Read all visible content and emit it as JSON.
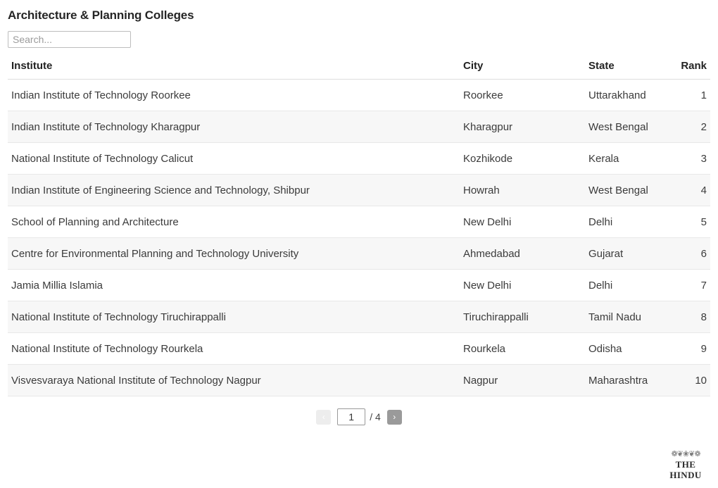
{
  "header": {
    "title": "Architecture & Planning Colleges"
  },
  "search": {
    "placeholder": "Search...",
    "value": ""
  },
  "table": {
    "columns": [
      {
        "key": "institute",
        "label": "Institute",
        "align": "left"
      },
      {
        "key": "city",
        "label": "City",
        "align": "left"
      },
      {
        "key": "state",
        "label": "State",
        "align": "left"
      },
      {
        "key": "rank",
        "label": "Rank",
        "align": "right"
      }
    ],
    "rows": [
      {
        "institute": "Indian Institute of Technology Roorkee",
        "city": "Roorkee",
        "state": "Uttarakhand",
        "rank": "1"
      },
      {
        "institute": "Indian Institute of Technology Kharagpur",
        "city": "Kharagpur",
        "state": "West Bengal",
        "rank": "2"
      },
      {
        "institute": "National Institute of Technology Calicut",
        "city": "Kozhikode",
        "state": "Kerala",
        "rank": "3"
      },
      {
        "institute": "Indian Institute of Engineering Science and Technology, Shibpur",
        "city": "Howrah",
        "state": "West Bengal",
        "rank": "4"
      },
      {
        "institute": "School of Planning and Architecture",
        "city": "New Delhi",
        "state": "Delhi",
        "rank": "5"
      },
      {
        "institute": "Centre for Environmental Planning and Technology University",
        "city": "Ahmedabad",
        "state": "Gujarat",
        "rank": "6"
      },
      {
        "institute": "Jamia Millia Islamia",
        "city": "New Delhi",
        "state": "Delhi",
        "rank": "7"
      },
      {
        "institute": "National Institute of Technology Tiruchirappalli",
        "city": "Tiruchirappalli",
        "state": "Tamil Nadu",
        "rank": "8"
      },
      {
        "institute": "National Institute of Technology Rourkela",
        "city": "Rourkela",
        "state": "Odisha",
        "rank": "9"
      },
      {
        "institute": "Visvesvaraya National Institute of Technology Nagpur",
        "city": "Nagpur",
        "state": "Maharashtra",
        "rank": "10"
      }
    ]
  },
  "pagination": {
    "prev_label": "‹",
    "next_label": "›",
    "current_page": "1",
    "total_label": "/ 4",
    "total_pages": "4",
    "prev_enabled": false,
    "next_enabled": true,
    "prev_color": "#ededed",
    "next_color": "#9a9a9a"
  },
  "footer": {
    "logo_ornament": "❁❦❀❦❁",
    "logo_text": "THE HINDU"
  },
  "theme": {
    "background": "#ffffff",
    "text": "#333333",
    "stripe": "#f7f7f7",
    "border": "#e8e8e8",
    "header_border": "#dddddd"
  }
}
